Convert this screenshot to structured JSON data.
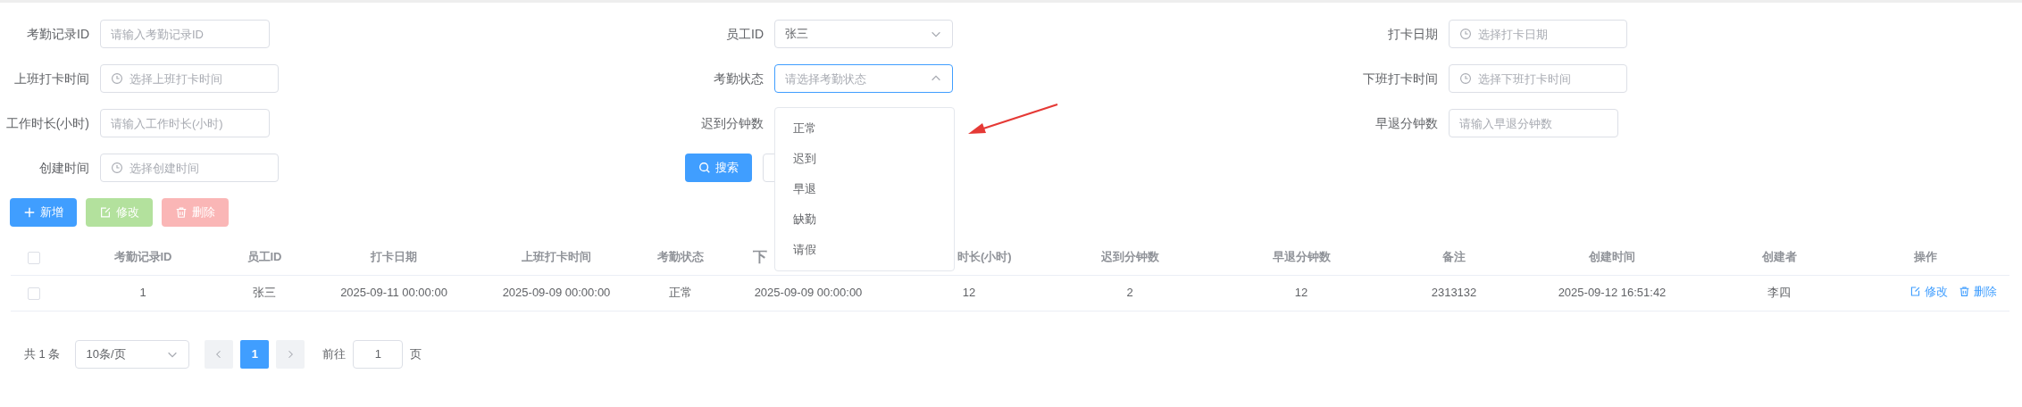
{
  "form": {
    "fields": [
      {
        "label": "考勤记录ID",
        "kind": "input",
        "placeholder": "请输入考勤记录ID"
      },
      {
        "label": "员工ID",
        "kind": "select",
        "value": "张三",
        "expanded": false
      },
      {
        "label": "打卡日期",
        "kind": "date",
        "placeholder": "选择打卡日期"
      },
      {
        "label": "上班打卡时间",
        "kind": "date",
        "placeholder": "选择上班打卡时间"
      },
      {
        "label": "考勤状态",
        "kind": "select",
        "placeholder": "请选择考勤状态",
        "expanded": true
      },
      {
        "label": "下班打卡时间",
        "kind": "date",
        "placeholder": "选择下班打卡时间"
      },
      {
        "label": "工作时长(小时)",
        "kind": "input",
        "placeholder": "请输入工作时长(小时)"
      },
      {
        "label": "迟到分钟数",
        "kind": "covered"
      },
      {
        "label": "早退分钟数",
        "kind": "input",
        "placeholder": "请输入早退分钟数"
      },
      {
        "label": "创建时间",
        "kind": "date",
        "placeholder": "选择创建时间"
      }
    ],
    "search_button": "搜索"
  },
  "dropdown": {
    "options": [
      {
        "label": "正常"
      },
      {
        "label": "迟到"
      },
      {
        "label": "早退"
      },
      {
        "label": "缺勤"
      },
      {
        "label": "请假"
      }
    ]
  },
  "toolbar": [
    {
      "kind": "add",
      "label": "新增",
      "disabled": false
    },
    {
      "kind": "edit",
      "label": "修改",
      "disabled": true
    },
    {
      "kind": "delete",
      "label": "删除",
      "disabled": true
    }
  ],
  "table": {
    "header_checked": false,
    "columns": [
      "考勤记录ID",
      "员工ID",
      "打卡日期",
      "上班打卡时间",
      "考勤状态",
      "下",
      "时长(小时)",
      "迟到分钟数",
      "早退分钟数",
      "备注",
      "创建时间",
      "创建者",
      "操作"
    ],
    "rows": [
      {
        "checked": false,
        "cells": [
          "1",
          "张三",
          "2025-09-11 00:00:00",
          "2025-09-09 00:00:00",
          "正常",
          "2025-09-09 00:00:00",
          "12",
          "2",
          "12",
          "2313132",
          "2025-09-12 16:51:42",
          "李四"
        ],
        "actions": [
          {
            "kind": "edit",
            "label": "修改"
          },
          {
            "kind": "delete",
            "label": "删除"
          }
        ]
      }
    ]
  },
  "pagination": {
    "total": "共 1 条",
    "page_size": "10条/页",
    "pages": [
      {
        "label": "1",
        "selected": true
      }
    ],
    "goto_label": "前往",
    "goto_value": "1",
    "page_suffix": "页"
  }
}
